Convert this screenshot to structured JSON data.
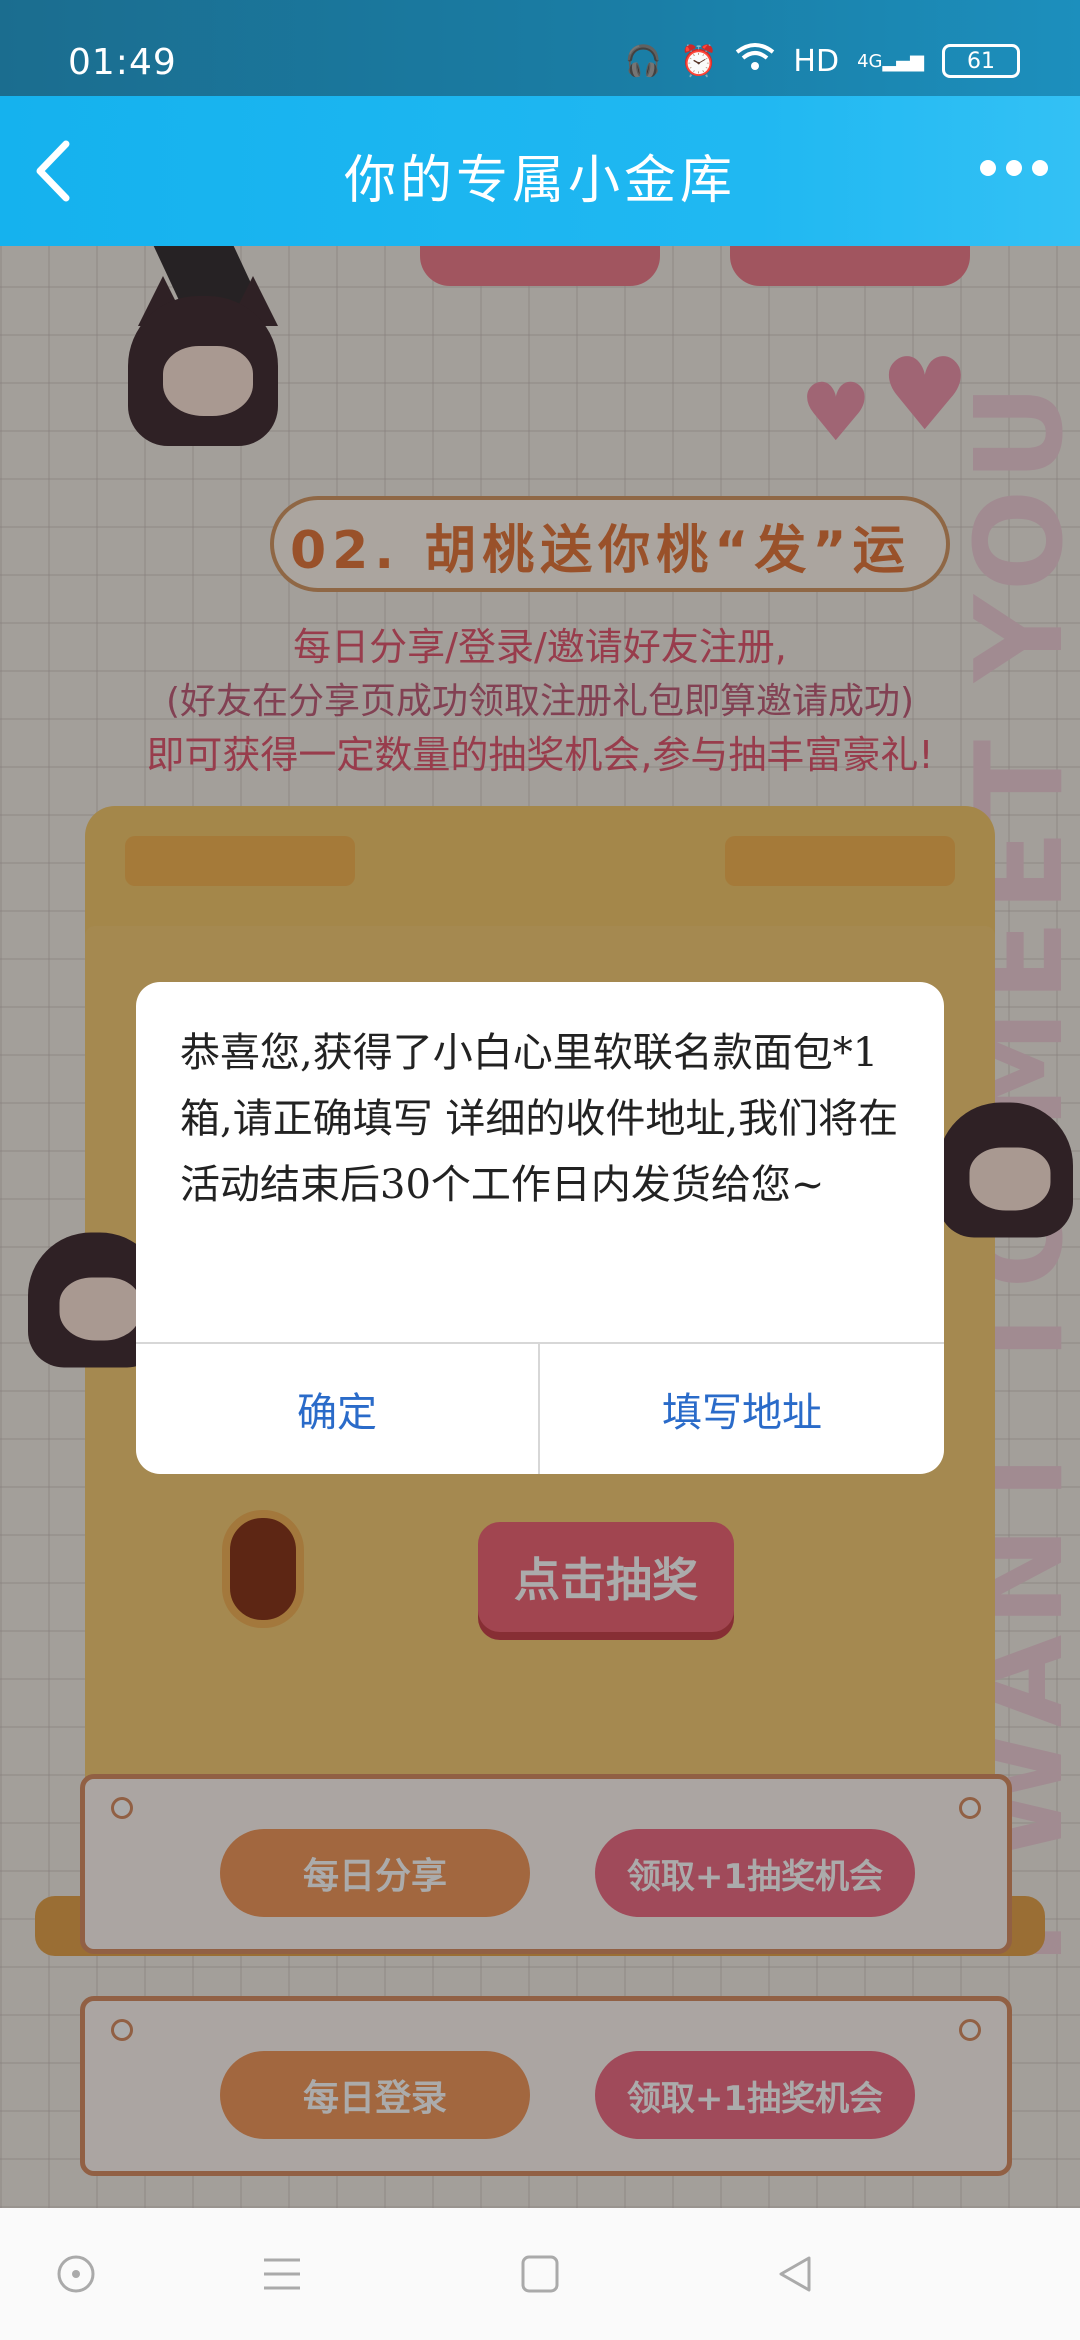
{
  "status_bar": {
    "time": "01:49",
    "network_label": "HD",
    "network_type": "4G",
    "battery": "61"
  },
  "header": {
    "title": "你的专属小金库"
  },
  "section": {
    "title": "02. 胡桃送你桃“发”运",
    "desc_line1": "每日分享/登录/邀请好友注册,",
    "desc_line2": "(好友在分享页成功领取注册礼包即算邀请成功)",
    "desc_line3": "即可获得一定数量的抽奖机会,参与抽丰富豪礼!",
    "side_text": "I WANT TO MEET YOU"
  },
  "machine": {
    "draw_label": "点击抽奖"
  },
  "tasks": [
    {
      "action": "每日分享",
      "reward": "领取+1抽奖机会"
    },
    {
      "action": "每日登录",
      "reward": "领取+1抽奖机会"
    }
  ],
  "dialog": {
    "message": "恭喜您,获得了小白心里软联名款面包*1箱,请正确填写 详细的收件地址,我们将在活动结束后30个工作日内发货给您~",
    "confirm_label": "确定",
    "address_label": "填写地址"
  },
  "colors": {
    "header_blue": "#1fb6f1",
    "dialog_link": "#2a6bc9",
    "accent_pink": "#ef6f86"
  }
}
